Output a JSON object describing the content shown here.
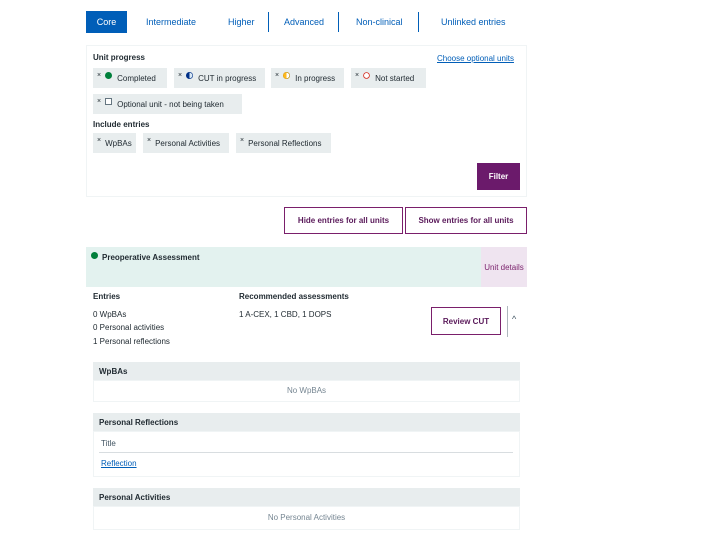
{
  "tabs": [
    {
      "label": "Core",
      "active": true
    },
    {
      "label": "Intermediate",
      "active": false
    },
    {
      "label": "Higher",
      "active": false
    },
    {
      "label": "Advanced",
      "active": false
    },
    {
      "label": "Non-clinical",
      "active": false
    },
    {
      "label": "Unlinked entries",
      "active": false
    }
  ],
  "filter": {
    "unit_progress_label": "Unit progress",
    "choose_optional_link": "Choose optional units",
    "progress_chips": [
      {
        "label": "Completed",
        "icon": "green-dot-icon"
      },
      {
        "label": "CUT in progress",
        "icon": "blue-half-circle-icon"
      },
      {
        "label": "In progress",
        "icon": "yellow-half-circle-icon"
      },
      {
        "label": "Not started",
        "icon": "empty-circle-icon"
      },
      {
        "label": "Optional unit - not being taken",
        "icon": "square-icon"
      }
    ],
    "include_entries_label": "Include entries",
    "entry_chips": [
      "WpBAs",
      "Personal Activities",
      "Personal Reflections"
    ],
    "chip_remove_glyph": "×",
    "filter_button": "Filter"
  },
  "actions": {
    "hide_all": "Hide entries for all units",
    "show_all": "Show entries for all units"
  },
  "unit": {
    "title": "Preoperative Assessment",
    "status_color": "#007f3b",
    "details_button": "Unit details",
    "entries_label": "Entries",
    "entries": [
      "0 WpBAs",
      "0 Personal activities",
      "1 Personal reflections"
    ],
    "recommended_label": "Recommended assessments",
    "recommended_value": "1 A-CEX, 1 CBD, 1 DOPS",
    "review_button": "Review CUT",
    "collapse_glyph": "^"
  },
  "sections": {
    "wpbas": {
      "title": "WpBAs",
      "empty": "No WpBAs"
    },
    "reflections": {
      "title": "Personal Reflections",
      "column": "Title",
      "rows": [
        "Reflection"
      ]
    },
    "activities": {
      "title": "Personal Activities",
      "empty": "No Personal Activities"
    }
  },
  "colors": {
    "accent_blue": "#005eb8",
    "purple": "#6b1a6b",
    "green": "#007f3b",
    "yellow": "#ffb81c",
    "red": "#d5281b"
  }
}
